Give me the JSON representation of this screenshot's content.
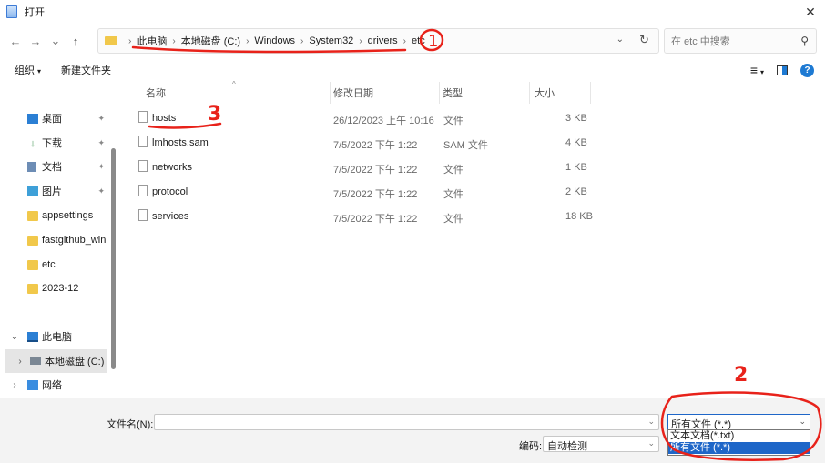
{
  "window": {
    "title": "打开",
    "close_glyph": "✕"
  },
  "nav": {
    "back": "←",
    "forward": "→",
    "recent": "⌄",
    "up": "↑",
    "breadcrumb": [
      "此电脑",
      "本地磁盘 (C:)",
      "Windows",
      "System32",
      "drivers",
      "etc"
    ],
    "separator": "›",
    "dropdown_glyph": "⌄",
    "refresh_glyph": "↻"
  },
  "search": {
    "placeholder": "在 etc 中搜索",
    "icon_glyph": "⚲"
  },
  "toolbar": {
    "organize": "组织",
    "new_folder": "新建文件夹",
    "view_glyph": "≡",
    "help": "?"
  },
  "sidebar": {
    "quick_access": [
      {
        "label": "桌面",
        "icon": "desktop-icon",
        "pinned": true
      },
      {
        "label": "下载",
        "icon": "download-icon",
        "pinned": true
      },
      {
        "label": "文档",
        "icon": "document-icon",
        "pinned": true
      },
      {
        "label": "图片",
        "icon": "pictures-icon",
        "pinned": true
      },
      {
        "label": "appsettings",
        "icon": "folder-icon",
        "pinned": false
      },
      {
        "label": "fastgithub_win",
        "icon": "folder-icon",
        "pinned": false
      },
      {
        "label": "etc",
        "icon": "folder-icon",
        "pinned": false
      },
      {
        "label": "2023-12",
        "icon": "folder-icon",
        "pinned": false
      }
    ],
    "this_pc": "此电脑",
    "local_disk": "本地磁盘 (C:)",
    "network": "网络",
    "pin_glyph": "📌",
    "chevron": "›"
  },
  "columns": {
    "name": "名称",
    "date": "修改日期",
    "type": "类型",
    "size": "大小"
  },
  "files": [
    {
      "name": "hosts",
      "date": "26/12/2023 上午 10:16",
      "type": "文件",
      "size": "3 KB"
    },
    {
      "name": "lmhosts.sam",
      "date": "7/5/2022 下午 1:22",
      "type": "SAM 文件",
      "size": "4 KB"
    },
    {
      "name": "networks",
      "date": "7/5/2022 下午 1:22",
      "type": "文件",
      "size": "1 KB"
    },
    {
      "name": "protocol",
      "date": "7/5/2022 下午 1:22",
      "type": "文件",
      "size": "2 KB"
    },
    {
      "name": "services",
      "date": "7/5/2022 下午 1:22",
      "type": "文件",
      "size": "18 KB"
    }
  ],
  "bottom": {
    "filename_label": "文件名(N):",
    "filename_value": "",
    "encoding_label": "编码:",
    "encoding_value": "自动检测",
    "filetype_value": "所有文件  (*.*)",
    "filetype_options": [
      "文本文档(*.txt)",
      "所有文件  (*.*)"
    ]
  },
  "annotations": {
    "one": "1",
    "two": "2",
    "three": "3",
    "color": "#e8221a"
  }
}
